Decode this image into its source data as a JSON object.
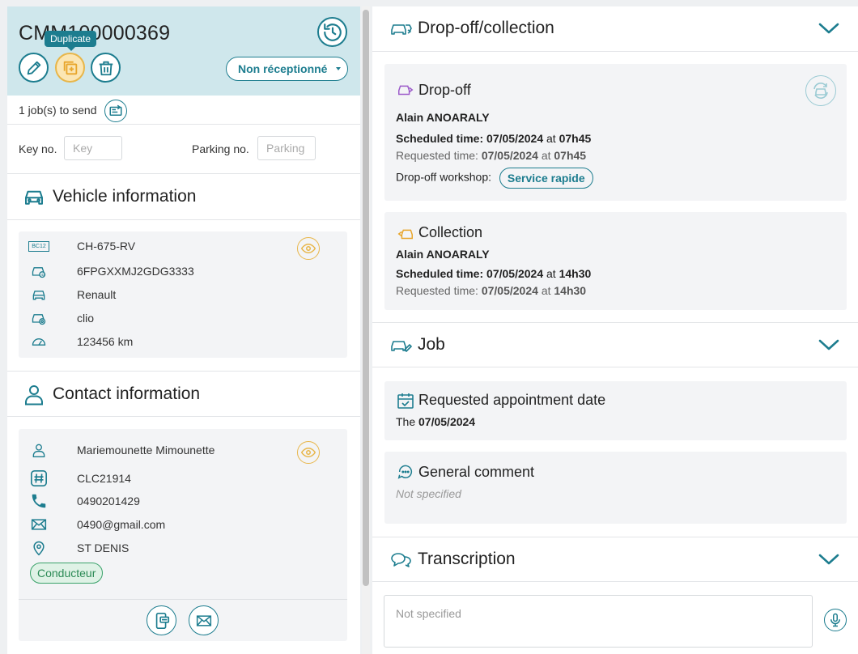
{
  "header": {
    "reference": "CMM100000369",
    "tooltip": "Duplicate",
    "status_label": "Non réceptionné"
  },
  "jobs": {
    "text": "1 job(s) to send"
  },
  "keys": {
    "key_label": "Key no.",
    "key_placeholder": "Key",
    "parking_label": "Parking no.",
    "parking_placeholder": "Parking"
  },
  "vehicle": {
    "title": "Vehicle information",
    "plate": "CH-675-RV",
    "vin": "6FPGXXMJ2GDG3333",
    "brand": "Renault",
    "model": "clio",
    "mileage": "123456 km",
    "plate_badge": "BC12"
  },
  "contact": {
    "title": "Contact information",
    "name": "Mariemounette Mimounette",
    "code": "CLC21914",
    "phone": "0490201429",
    "email": "0490@gmail.com",
    "city": "ST DENIS",
    "role": "Conducteur"
  },
  "dropoff_collection": {
    "title": "Drop-off/collection",
    "dropoff": {
      "title": "Drop-off",
      "person": "Alain ANOARALY",
      "scheduled_label": "Scheduled time:",
      "scheduled_date": "07/05/2024",
      "at": "at",
      "scheduled_time": "07h45",
      "requested_label": "Requested time:",
      "requested_date": "07/05/2024",
      "requested_time": "07h45",
      "workshop_label": "Drop-off workshop:",
      "workshop": "Service rapide"
    },
    "collection": {
      "title": "Collection",
      "person": "Alain ANOARALY",
      "scheduled_label": "Scheduled time:",
      "scheduled_date": "07/05/2024",
      "at": "at",
      "scheduled_time": "14h30",
      "requested_label": "Requested time:",
      "requested_date": "07/05/2024",
      "requested_time": "14h30"
    }
  },
  "job": {
    "title": "Job",
    "appointment_title": "Requested appointment date",
    "appointment_prefix": "The",
    "appointment_date": "07/05/2024",
    "comment_title": "General comment",
    "comment_value": "Not specified"
  },
  "transcription": {
    "title": "Transcription",
    "placeholder": "Not specified"
  },
  "colors": {
    "accent": "#1d7d8f",
    "header_bg": "#cfe7ec",
    "highlight": "#e8b64a",
    "driver_tag": "#3aa26a"
  },
  "icons": [
    "history-icon",
    "pencil-icon",
    "duplicate-icon",
    "trash-icon",
    "send-icon",
    "car-icon",
    "plate-icon",
    "vin-icon",
    "brand-icon",
    "model-icon",
    "speedometer-icon",
    "eye-icon",
    "person-icon",
    "hash-icon",
    "phone-icon",
    "envelope-icon",
    "location-icon",
    "sms-icon",
    "mail-icon",
    "chevron-down-icon",
    "dropoff-icon",
    "collection-icon",
    "calendar-icon",
    "comment-icon",
    "chat-icon",
    "microphone-icon",
    "refresh-icon"
  ]
}
